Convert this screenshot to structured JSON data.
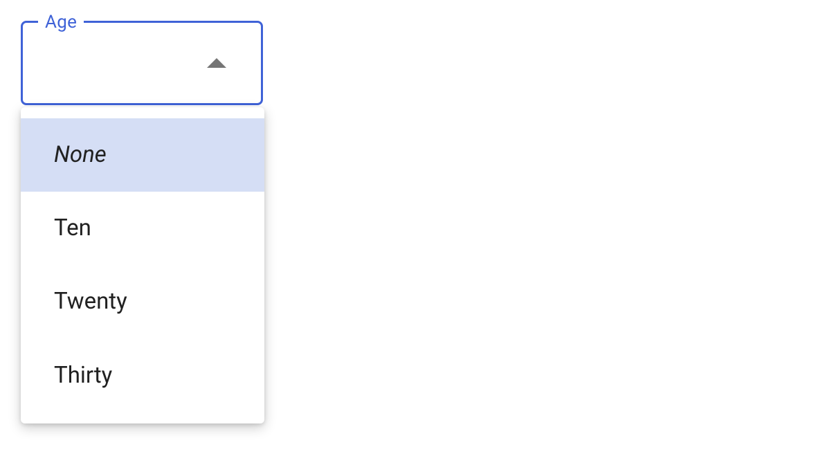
{
  "select": {
    "label": "Age",
    "selected_value": "",
    "options": [
      {
        "label": "None",
        "is_none": true,
        "selected": true
      },
      {
        "label": "Ten",
        "is_none": false,
        "selected": false
      },
      {
        "label": "Twenty",
        "is_none": false,
        "selected": false
      },
      {
        "label": "Thirty",
        "is_none": false,
        "selected": false
      }
    ]
  },
  "colors": {
    "primary": "#3f62d7",
    "selected_bg": "#d5def5"
  }
}
